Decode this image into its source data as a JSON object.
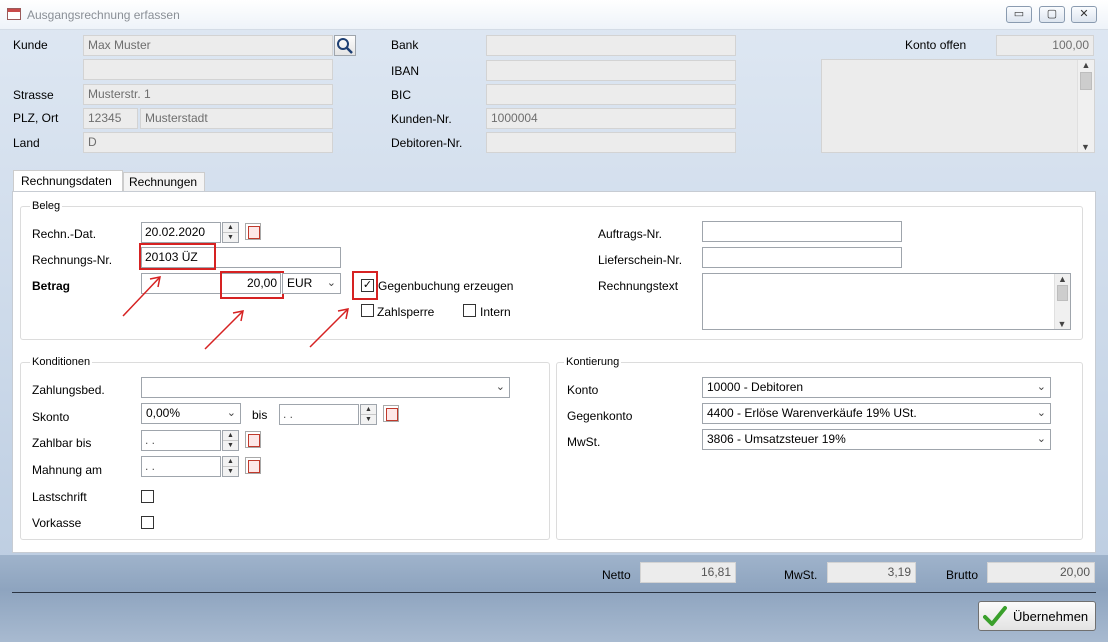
{
  "window": {
    "title": "Ausgangsrechnung erfassen",
    "minimize": "▭",
    "maximize": "▢",
    "close": "✕"
  },
  "customer": {
    "kunde_label": "Kunde",
    "kunde_value": "Max Muster",
    "kunde2_value": "",
    "strasse_label": "Strasse",
    "strasse_value": "Musterstr. 1",
    "plzort_label": "PLZ, Ort",
    "plz_value": "12345",
    "ort_value": "Musterstadt",
    "land_label": "Land",
    "land_value": "D",
    "bank_label": "Bank",
    "iban_label": "IBAN",
    "bic_label": "BIC",
    "kundennr_label": "Kunden-Nr.",
    "kundennr_value": "1000004",
    "debitorennr_label": "Debitoren-Nr.",
    "konto_offen_label": "Konto offen",
    "konto_offen_value": "100,00"
  },
  "tabs": [
    {
      "label": "Rechnungsdaten",
      "active": true
    },
    {
      "label": "Rechnungen",
      "active": false
    }
  ],
  "beleg": {
    "title": "Beleg",
    "rechn_dat_label": "Rechn.-Dat.",
    "rechn_dat_value": "20.02.2020",
    "rechnungsnr_label": "Rechnungs-Nr.",
    "rechnungsnr_value": "20103 ÜZ",
    "betrag_label": "Betrag",
    "betrag_value": "20,00",
    "currency": "EUR",
    "gegenbuchung_label": "Gegenbuchung erzeugen",
    "gegenbuchung_checked": true,
    "zahlsperre_label": "Zahlsperre",
    "intern_label": "Intern",
    "auftragsnr_label": "Auftrags-Nr.",
    "lieferscheinnr_label": "Lieferschein-Nr.",
    "rechnungstext_label": "Rechnungstext"
  },
  "konditionen": {
    "title": "Konditionen",
    "zahlungsbed_label": "Zahlungsbed.",
    "skonto_label": "Skonto",
    "skonto_value": "0,00%",
    "bis_label": "bis",
    "bis_value": " .  .",
    "zahlbar_label": "Zahlbar bis",
    "zahlbar_value": " .  .",
    "mahnung_label": "Mahnung am",
    "mahnung_value": " .  .",
    "lastschrift_label": "Lastschrift",
    "vorkasse_label": "Vorkasse"
  },
  "kontierung": {
    "title": "Kontierung",
    "konto_label": "Konto",
    "konto_value": "10000  - Debitoren",
    "gegenkonto_label": "Gegenkonto",
    "gegenkonto_value": "4400 - Erlöse Warenverkäufe 19% USt.",
    "mwst_label": "MwSt.",
    "mwst_value": "3806 - Umsatzsteuer 19%"
  },
  "totals": {
    "netto_label": "Netto",
    "netto_value": "16,81",
    "mwst_label": "MwSt.",
    "mwst_value": "3,19",
    "brutto_label": "Brutto",
    "brutto_value": "20,00"
  },
  "ok_button": {
    "label": "Übernehmen"
  },
  "icons": {
    "search": "search-icon",
    "calendar": "calendar-icon",
    "check": "checkmark-icon"
  },
  "colors": {
    "annotation_red": "#d62222",
    "ok_green": "#3aa02c"
  }
}
